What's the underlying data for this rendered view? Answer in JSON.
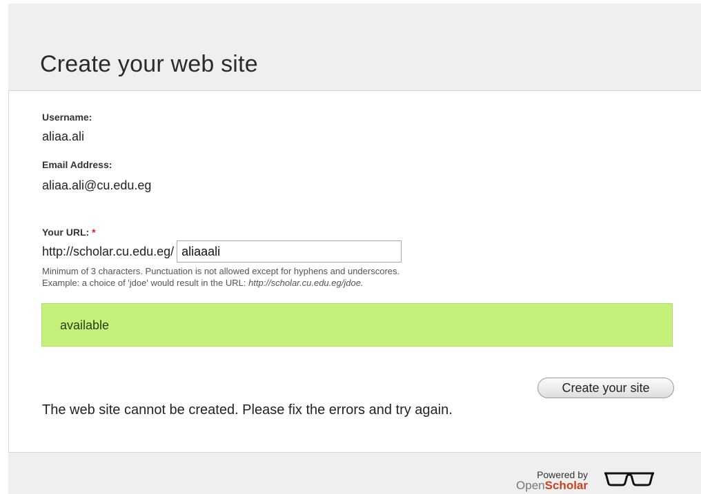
{
  "page": {
    "title": "Create your web site"
  },
  "form": {
    "username_label": "Username:",
    "username_value": "aliaa.ali",
    "email_label": "Email Address:",
    "email_value": "aliaa.ali@cu.edu.eg",
    "url_label": "Your URL:",
    "url_required_marker": "*",
    "url_prefix": "http://scholar.cu.edu.eg/",
    "url_value": "aliaaali",
    "help_line_1": "Minimum of 3 characters. Punctuation is not allowed except for hyphens and underscores.",
    "help_line_2_text": "Example: a choice of 'jdoe' would result in the URL: ",
    "help_line_2_url": "http://scholar.cu.edu.eg/jdoe."
  },
  "status": {
    "text": "available",
    "color": "#c5f07a"
  },
  "actions": {
    "create_label": "Create your site"
  },
  "messages": {
    "error": "The web site cannot be created. Please fix the errors and try again."
  },
  "footer": {
    "powered_by": "Powered by",
    "brand_open": "Open",
    "brand_scholar": "Scholar",
    "logo_icon": "glasses-icon",
    "brand_color": "#c9421e"
  }
}
